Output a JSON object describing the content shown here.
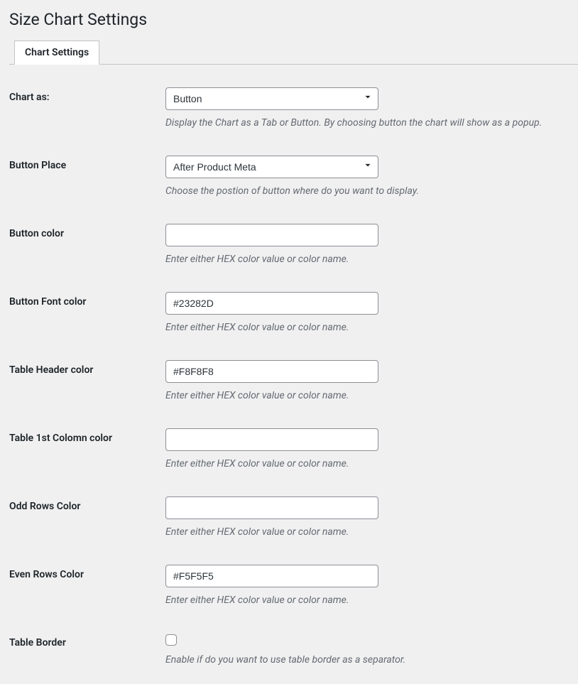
{
  "page": {
    "title": "Size Chart Settings"
  },
  "tabs": {
    "chart_settings": "Chart Settings"
  },
  "fields": {
    "chart_as": {
      "label": "Chart as:",
      "value": "Button",
      "help": "Display the Chart as a Tab or Button. By choosing button the chart will show as a popup."
    },
    "button_place": {
      "label": "Button Place",
      "value": "After Product Meta",
      "help": "Choose the postion of button where do you want to display."
    },
    "button_color": {
      "label": "Button color",
      "value": "",
      "help": "Enter either HEX color value or color name."
    },
    "button_font_color": {
      "label": "Button Font color",
      "value": "#23282D",
      "help": "Enter either HEX color value or color name."
    },
    "table_header_color": {
      "label": "Table Header color",
      "value": "#F8F8F8",
      "help": "Enter either HEX color value or color name."
    },
    "table_first_column_color": {
      "label": "Table 1st Colomn color",
      "value": "",
      "help": "Enter either HEX color value or color name."
    },
    "odd_rows_color": {
      "label": "Odd Rows Color",
      "value": "",
      "help": "Enter either HEX color value or color name."
    },
    "even_rows_color": {
      "label": "Even Rows Color",
      "value": "#F5F5F5",
      "help": "Enter either HEX color value or color name."
    },
    "table_border": {
      "label": "Table Border",
      "checked": false,
      "help": "Enable if do you want to use table border as a separator."
    }
  }
}
